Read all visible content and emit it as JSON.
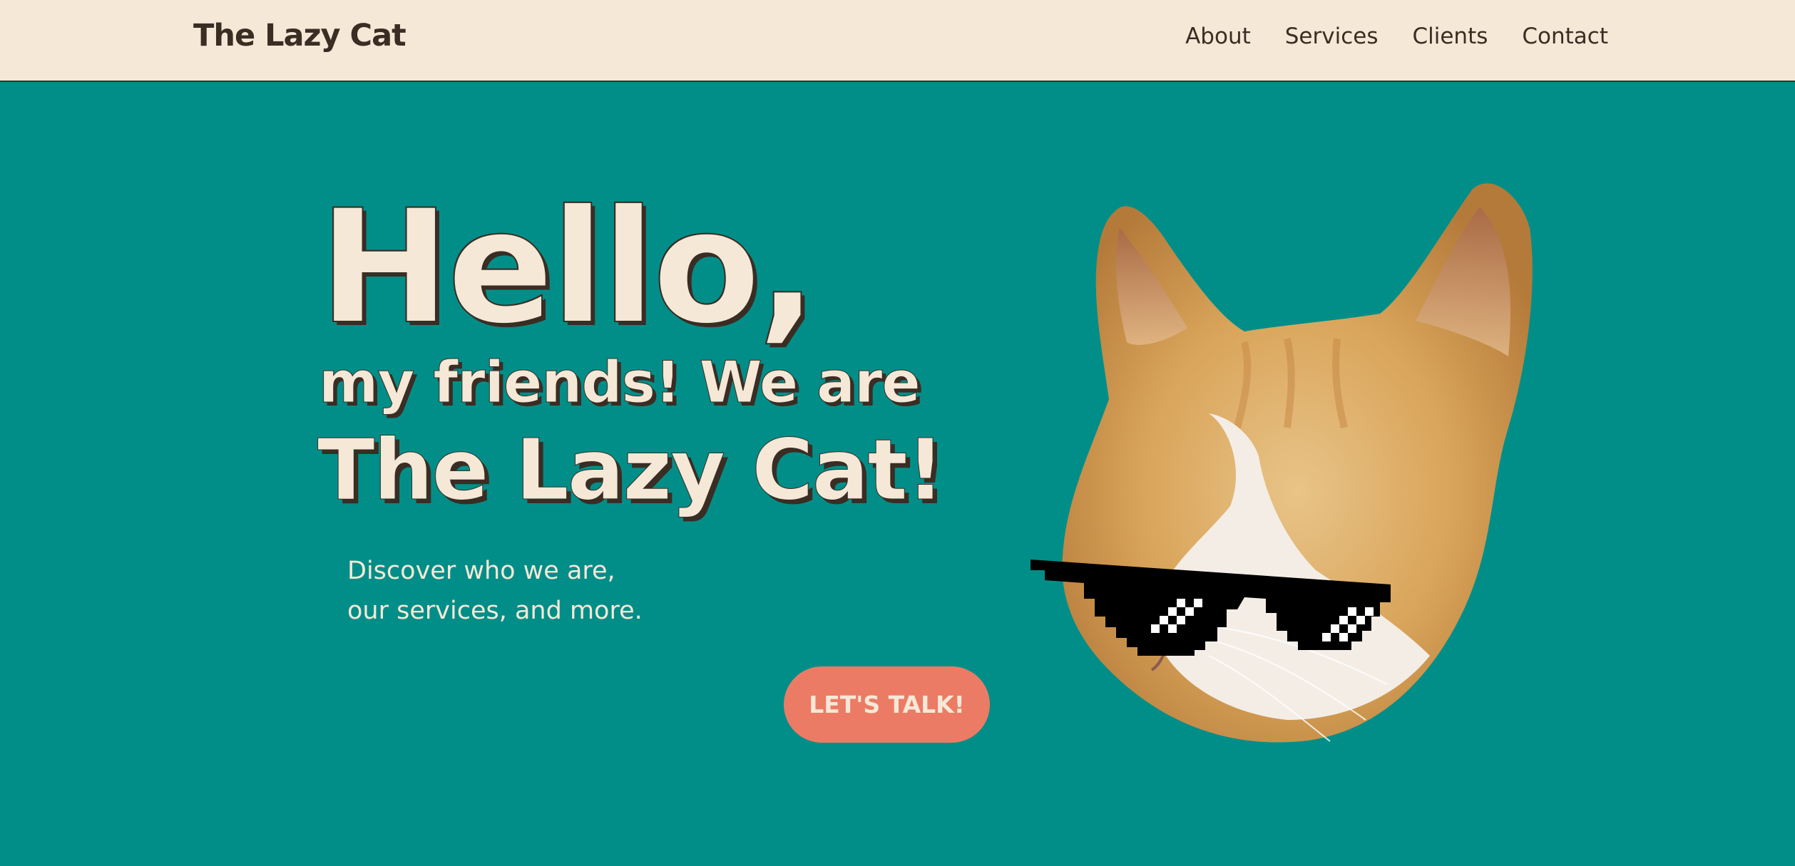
{
  "header": {
    "brand": "The Lazy Cat",
    "nav": [
      {
        "label": "About"
      },
      {
        "label": "Services"
      },
      {
        "label": "Clients"
      },
      {
        "label": "Contact"
      }
    ]
  },
  "hero": {
    "line1": "Hello,",
    "line2": "my friends! We are",
    "line3": "The Lazy Cat!",
    "subtitle_line1": "Discover who we are,",
    "subtitle_line2": "our services, and more.",
    "cta_label": "LET'S TALK!"
  },
  "colors": {
    "background": "#028e88",
    "header_bg": "#f5e8d7",
    "text_dark": "#3a2d24",
    "accent": "#ec7b65"
  }
}
